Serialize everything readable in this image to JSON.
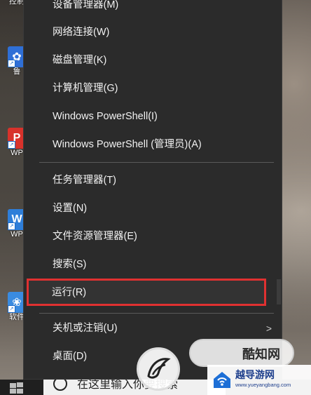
{
  "desktop": {
    "icons": [
      {
        "label": "控制",
        "glyph": "",
        "color": "#3b3b3b"
      },
      {
        "label": "鲁",
        "glyph": "✿",
        "color": "#2f6fd6"
      },
      {
        "label": "WP",
        "glyph": "P",
        "color": "#d8322b"
      },
      {
        "label": "WP",
        "glyph": "W",
        "color": "#2e7ed9"
      },
      {
        "label": "软件",
        "glyph": "❀",
        "color": "#3a8be0"
      }
    ]
  },
  "menu": {
    "items": [
      {
        "label": "设备管理器(M)"
      },
      {
        "label": "网络连接(W)"
      },
      {
        "label": "磁盘管理(K)"
      },
      {
        "label": "计算机管理(G)"
      },
      {
        "label": "Windows PowerShell(I)"
      },
      {
        "label": "Windows PowerShell (管理员)(A)"
      },
      {
        "label": "任务管理器(T)"
      },
      {
        "label": "设置(N)"
      },
      {
        "label": "文件资源管理器(E)"
      },
      {
        "label": "搜索(S)"
      },
      {
        "label": "运行(R)"
      },
      {
        "label": "关机或注销(U)"
      },
      {
        "label": "桌面(D)"
      }
    ],
    "highlighted_item": "运行(R)",
    "highlight_color": "#e03131"
  },
  "taskbar": {
    "search_placeholder": "在这里输入你要搜索"
  },
  "watermarks": {
    "badge_text": "酷知网",
    "brand_text": "越导游网",
    "brand_url": "www.yueyangbang.com"
  }
}
